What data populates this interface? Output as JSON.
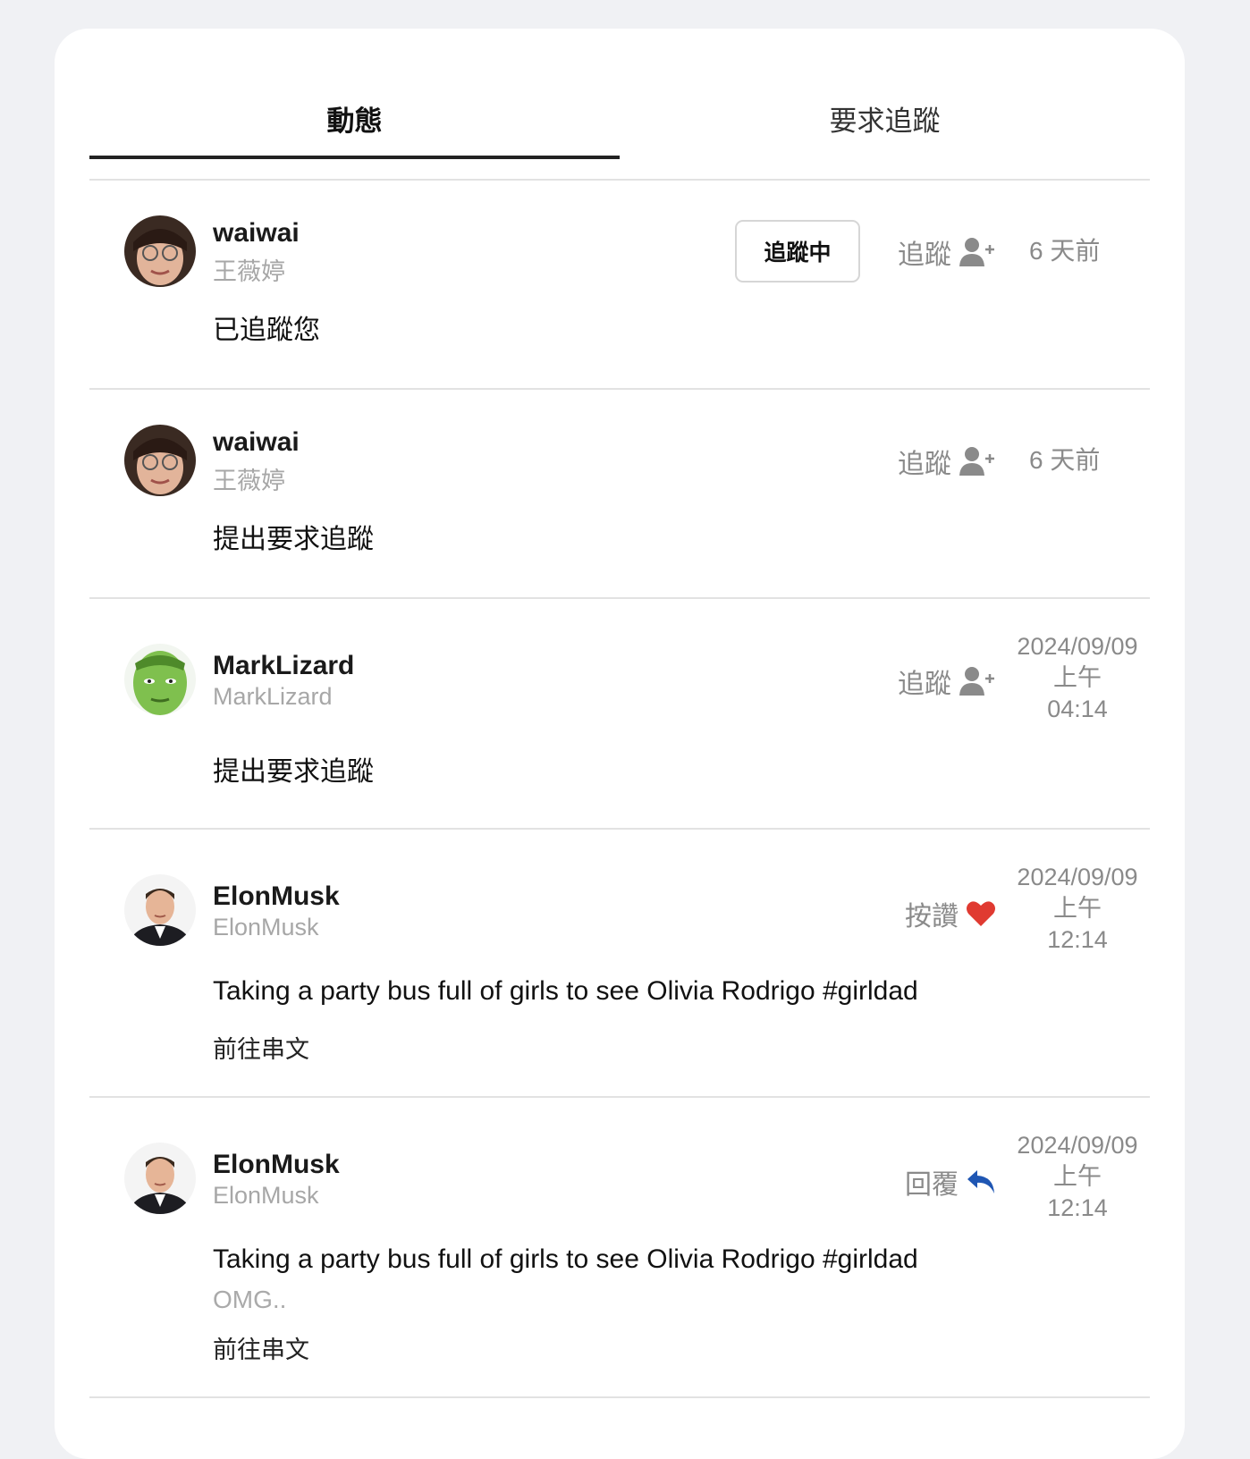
{
  "tabs": [
    {
      "label": "動態",
      "active": true
    },
    {
      "label": "要求追蹤",
      "active": false
    }
  ],
  "colors": {
    "like": "#e03a31",
    "reply": "#1f56b3",
    "muted": "#8a8a8a",
    "divider": "#e2e2e2"
  },
  "items": [
    {
      "name": "waiwai",
      "handle": "王薇婷",
      "message": "已追蹤您",
      "following_button": "追蹤中",
      "action": {
        "label": "追蹤",
        "icon": "user-plus-icon"
      },
      "time": "6 天前"
    },
    {
      "name": "waiwai",
      "handle": "王薇婷",
      "message": "提出要求追蹤",
      "action": {
        "label": "追蹤",
        "icon": "user-plus-icon"
      },
      "time": "6 天前"
    },
    {
      "name": "MarkLizard",
      "handle": "MarkLizard",
      "message": "提出要求追蹤",
      "action": {
        "label": "追蹤",
        "icon": "user-plus-icon"
      },
      "time_lines": [
        "2024/09/09",
        "上午",
        "04:14"
      ]
    },
    {
      "name": "ElonMusk",
      "handle": "ElonMusk",
      "message": "Taking a party bus full of girls to see Olivia Rodrigo #girldad",
      "link": "前往串文",
      "action": {
        "label": "按讚",
        "icon": "heart-icon"
      },
      "time_lines": [
        "2024/09/09",
        "上午",
        "12:14"
      ]
    },
    {
      "name": "ElonMusk",
      "handle": "ElonMusk",
      "message": "Taking a party bus full of girls to see Olivia Rodrigo #girldad",
      "sub_message": "OMG..",
      "link": "前往串文",
      "action": {
        "label": "回覆",
        "icon": "reply-icon"
      },
      "time_lines": [
        "2024/09/09",
        "上午",
        "12:14"
      ]
    }
  ]
}
